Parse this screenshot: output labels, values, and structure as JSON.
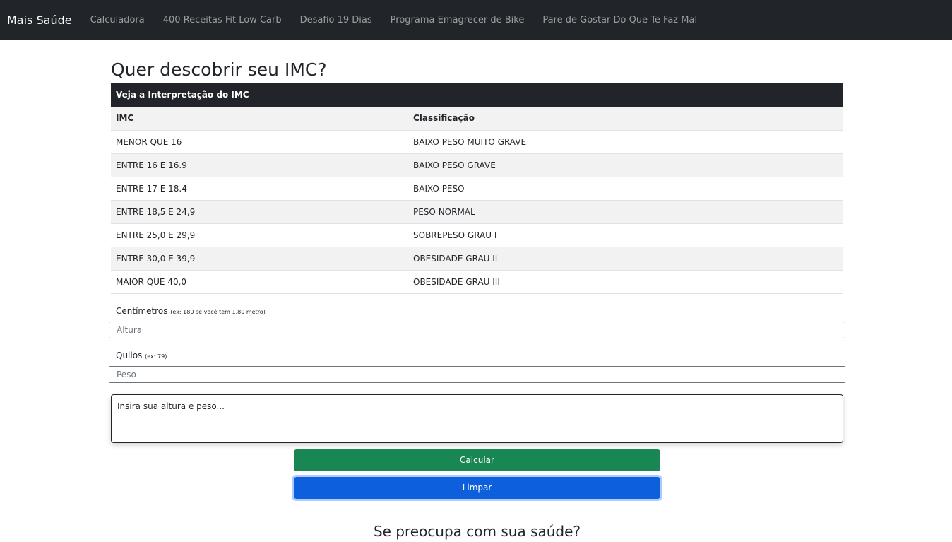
{
  "navbar": {
    "brand": "Mais Saúde",
    "links": [
      "Calculadora",
      "400 Receitas Fit Low Carb",
      "Desafio 19 Dias",
      "Programa Emagrecer de Bike",
      "Pare de Gostar Do Que Te Faz Mal"
    ]
  },
  "page": {
    "title": "Quer descobrir seu IMC?",
    "subtitle": "Se preocupa com sua saúde?"
  },
  "table": {
    "caption": "Veja a Interpretação do IMC",
    "headers": [
      "IMC",
      "Classificação"
    ],
    "rows": [
      [
        "MENOR QUE 16",
        "BAIXO PESO MUITO GRAVE"
      ],
      [
        "ENTRE 16 E 16.9",
        "BAIXO PESO GRAVE"
      ],
      [
        "ENTRE 17 E 18.4",
        "BAIXO PESO"
      ],
      [
        "ENTRE 18,5 E 24,9",
        "PESO NORMAL"
      ],
      [
        "ENTRE 25,0 E 29,9",
        "SOBREPESO GRAU I"
      ],
      [
        "ENTRE 30,0 E 39,9",
        "OBESIDADE GRAU II"
      ],
      [
        "MAIOR QUE 40,0",
        "OBESIDADE GRAU III"
      ]
    ]
  },
  "form": {
    "height_label": "Centímetros",
    "height_hint": "(ex: 180 se você tem 1.80 metro)",
    "height_placeholder": "Altura",
    "weight_label": "Quilos",
    "weight_hint": "(ex: 79)",
    "weight_placeholder": "Peso",
    "result_text": "Insira sua altura e peso...",
    "calc_button": "Calcular",
    "clear_button": "Limpar"
  },
  "colors": {
    "navbar_bg": "#212529",
    "calc_button": "#198754",
    "clear_button": "#0d5fdb"
  }
}
